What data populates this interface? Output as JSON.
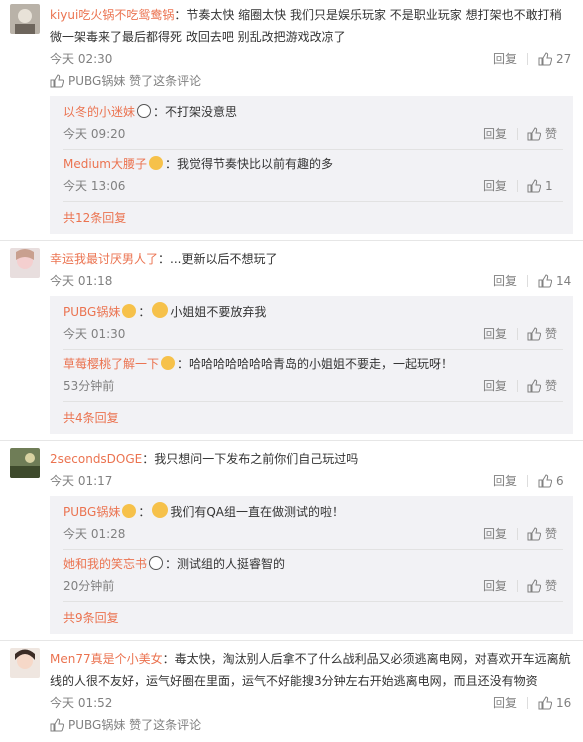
{
  "comments": [
    {
      "user": "kiyui吃火锅不吃鸳鸯锅",
      "text": "：节奏太快 缩圈太快 我们只是娱乐玩家 不是职业玩家 想打架也不敢打稍微一架毒来了最后都得死 改回去吧 别乱改把游戏改凉了",
      "time": "今天 02:30",
      "reply": "回复",
      "likes": "27",
      "liked_by": "PUBG锅妹 赞了这条评论",
      "replies": [
        {
          "user": "以冬的小迷妹",
          "text": "：不打架没意思",
          "time": "今天 09:20",
          "reply": "回复",
          "likes": "赞"
        },
        {
          "user": "Medium大腰子",
          "text": "：我觉得节奏快比以前有趣的多",
          "time": "今天 13:06",
          "reply": "回复",
          "likes": "1"
        }
      ],
      "more": "共12条回复"
    },
    {
      "user": "幸运我最讨厌男人了",
      "text": "：...更新以后不想玩了",
      "time": "今天 01:18",
      "reply": "回复",
      "likes": "14",
      "replies": [
        {
          "user": "PUBG锅妹",
          "text": "小姐姐不要放弃我",
          "time": "今天 01:30",
          "reply": "回复",
          "likes": "赞"
        },
        {
          "user": "草莓樱桃了解一下",
          "text": "：哈哈哈哈哈哈哈青岛的小姐姐不要走，一起玩呀！",
          "time": "53分钟前",
          "reply": "回复",
          "likes": "赞"
        }
      ],
      "more": "共4条回复"
    },
    {
      "user": "2secondsDOGE",
      "text": "：我只想问一下发布之前你们自己玩过吗",
      "time": "今天 01:17",
      "reply": "回复",
      "likes": "6",
      "replies": [
        {
          "user": "PUBG锅妹",
          "text": "我们有QA组一直在做测试的啦！",
          "time": "今天 01:28",
          "reply": "回复",
          "likes": "赞"
        },
        {
          "user": "她和我的笑忘书",
          "text": "：测试组的人挺睿智的",
          "time": "20分钟前",
          "reply": "回复",
          "likes": "赞"
        }
      ],
      "more": "共9条回复"
    },
    {
      "user": "Men77真是个小美女",
      "text": "：毒太快，淘汰别人后拿不了什么战利品又必须逃离电网，对喜欢开车远离航线的人很不友好，运气好圈在里面，运气不好能搜3分钟左右开始逃离电网，而且还没有物资",
      "time": "今天 01:52",
      "reply": "回复",
      "likes": "16",
      "liked_by": "PUBG锅妹 赞了这条评论"
    }
  ]
}
